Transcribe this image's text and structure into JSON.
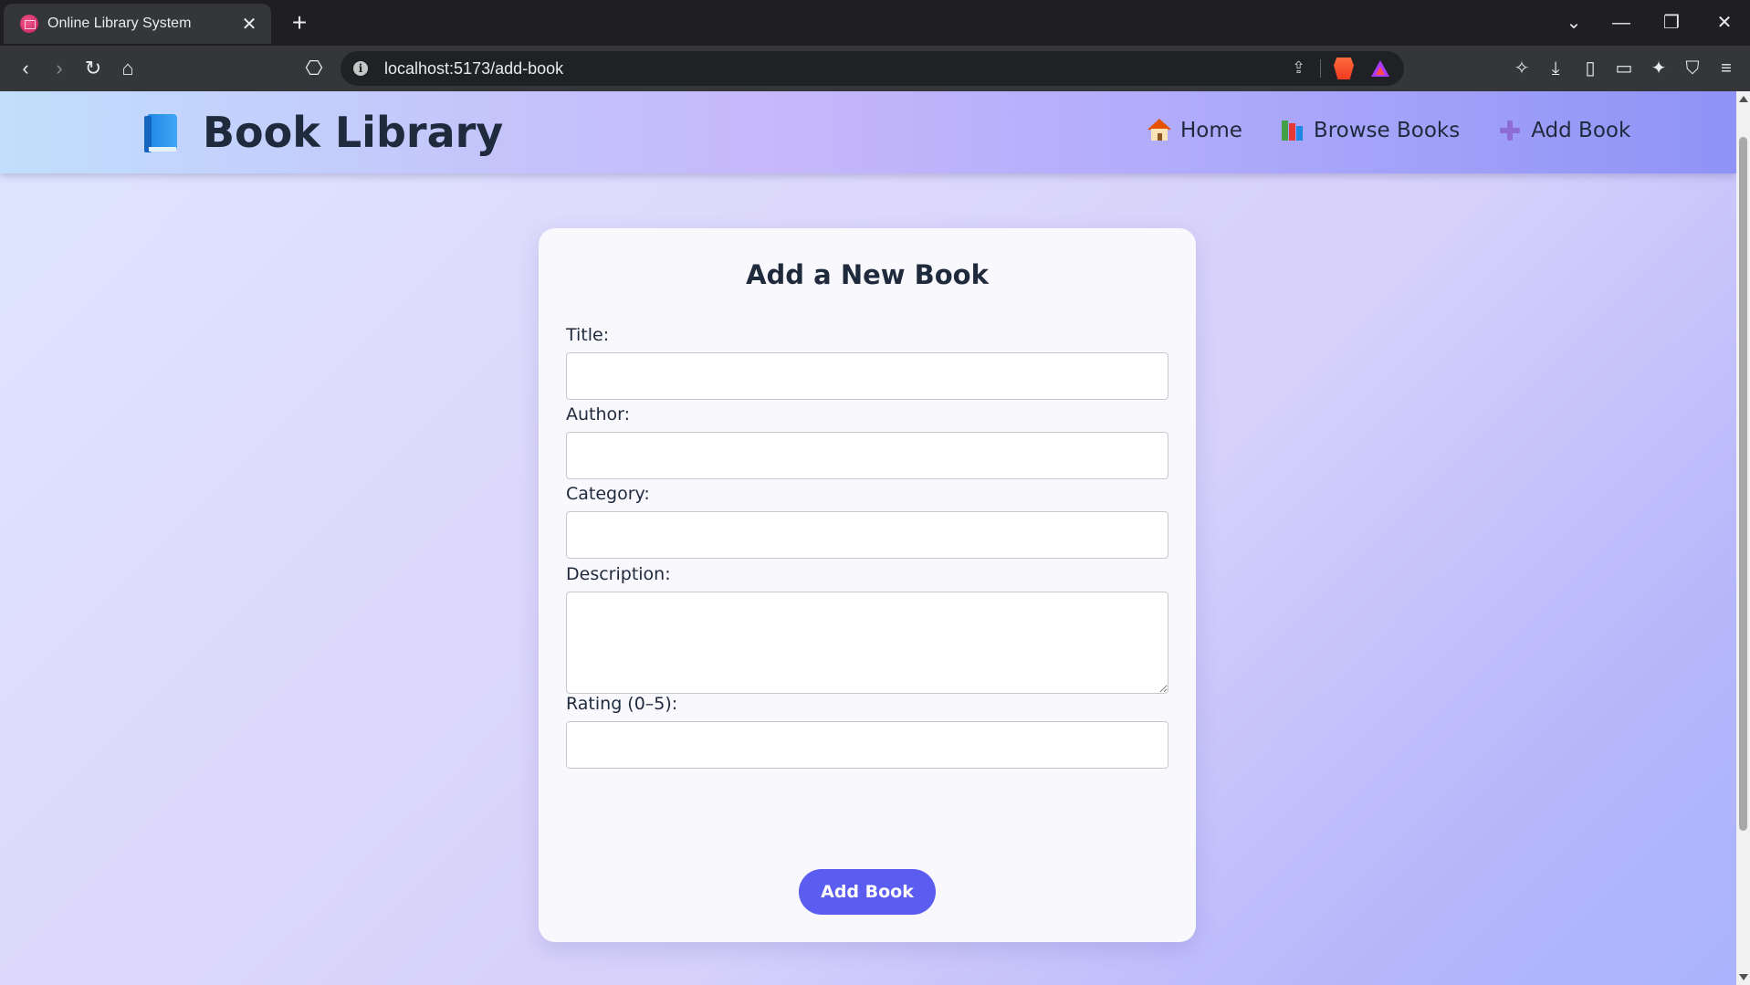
{
  "browser": {
    "tab_title": "Online Library System",
    "tab_close": "✕",
    "new_tab": "+",
    "url": "localhost:5173/add-book",
    "window_controls": {
      "tabs_dropdown": "⌄",
      "minimize": "—",
      "restore": "❐",
      "close": "✕"
    },
    "nav": {
      "back": "‹",
      "forward": "›",
      "reload": "↻",
      "home": "⌂",
      "bookmark": "⎔"
    },
    "omnibox_info": "i",
    "share": "⇪",
    "toolbar_icons": {
      "extensions": "✧",
      "downloads": "⤓",
      "sidebar": "▯",
      "wallet": "▭",
      "leo": "✦",
      "vpn": "⛉",
      "menu": "≡"
    }
  },
  "header": {
    "brand_title": "Book Library",
    "nav": [
      {
        "label": "Home",
        "icon": "house-icon"
      },
      {
        "label": "Browse Books",
        "icon": "books-icon"
      },
      {
        "label": "Add Book",
        "icon": "plus-icon"
      }
    ]
  },
  "form": {
    "heading": "Add a New Book",
    "fields": {
      "title": {
        "label": "Title:",
        "value": ""
      },
      "author": {
        "label": "Author:",
        "value": ""
      },
      "category": {
        "label": "Category:",
        "value": ""
      },
      "description": {
        "label": "Description:",
        "value": ""
      },
      "rating": {
        "label": "Rating (0–5):",
        "value": ""
      }
    },
    "submit_label": "Add Book"
  },
  "colors": {
    "accent": "#5b5cf0",
    "text": "#1f2a3d",
    "card": "#f8f8fd"
  }
}
